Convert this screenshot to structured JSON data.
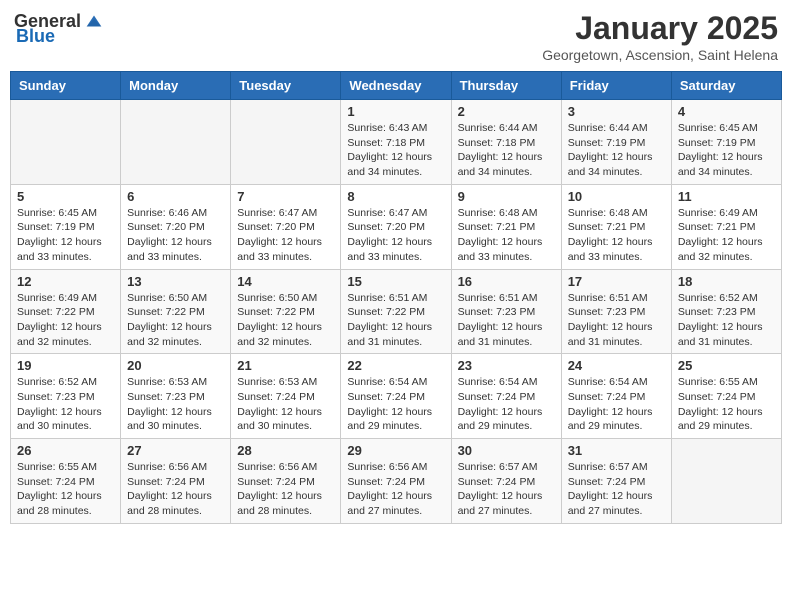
{
  "header": {
    "logo_general": "General",
    "logo_blue": "Blue",
    "month_title": "January 2025",
    "subtitle": "Georgetown, Ascension, Saint Helena"
  },
  "days_of_week": [
    "Sunday",
    "Monday",
    "Tuesday",
    "Wednesday",
    "Thursday",
    "Friday",
    "Saturday"
  ],
  "weeks": [
    [
      {
        "day": "",
        "info": ""
      },
      {
        "day": "",
        "info": ""
      },
      {
        "day": "",
        "info": ""
      },
      {
        "day": "1",
        "info": "Sunrise: 6:43 AM\nSunset: 7:18 PM\nDaylight: 12 hours\nand 34 minutes."
      },
      {
        "day": "2",
        "info": "Sunrise: 6:44 AM\nSunset: 7:18 PM\nDaylight: 12 hours\nand 34 minutes."
      },
      {
        "day": "3",
        "info": "Sunrise: 6:44 AM\nSunset: 7:19 PM\nDaylight: 12 hours\nand 34 minutes."
      },
      {
        "day": "4",
        "info": "Sunrise: 6:45 AM\nSunset: 7:19 PM\nDaylight: 12 hours\nand 34 minutes."
      }
    ],
    [
      {
        "day": "5",
        "info": "Sunrise: 6:45 AM\nSunset: 7:19 PM\nDaylight: 12 hours\nand 33 minutes."
      },
      {
        "day": "6",
        "info": "Sunrise: 6:46 AM\nSunset: 7:20 PM\nDaylight: 12 hours\nand 33 minutes."
      },
      {
        "day": "7",
        "info": "Sunrise: 6:47 AM\nSunset: 7:20 PM\nDaylight: 12 hours\nand 33 minutes."
      },
      {
        "day": "8",
        "info": "Sunrise: 6:47 AM\nSunset: 7:20 PM\nDaylight: 12 hours\nand 33 minutes."
      },
      {
        "day": "9",
        "info": "Sunrise: 6:48 AM\nSunset: 7:21 PM\nDaylight: 12 hours\nand 33 minutes."
      },
      {
        "day": "10",
        "info": "Sunrise: 6:48 AM\nSunset: 7:21 PM\nDaylight: 12 hours\nand 33 minutes."
      },
      {
        "day": "11",
        "info": "Sunrise: 6:49 AM\nSunset: 7:21 PM\nDaylight: 12 hours\nand 32 minutes."
      }
    ],
    [
      {
        "day": "12",
        "info": "Sunrise: 6:49 AM\nSunset: 7:22 PM\nDaylight: 12 hours\nand 32 minutes."
      },
      {
        "day": "13",
        "info": "Sunrise: 6:50 AM\nSunset: 7:22 PM\nDaylight: 12 hours\nand 32 minutes."
      },
      {
        "day": "14",
        "info": "Sunrise: 6:50 AM\nSunset: 7:22 PM\nDaylight: 12 hours\nand 32 minutes."
      },
      {
        "day": "15",
        "info": "Sunrise: 6:51 AM\nSunset: 7:22 PM\nDaylight: 12 hours\nand 31 minutes."
      },
      {
        "day": "16",
        "info": "Sunrise: 6:51 AM\nSunset: 7:23 PM\nDaylight: 12 hours\nand 31 minutes."
      },
      {
        "day": "17",
        "info": "Sunrise: 6:51 AM\nSunset: 7:23 PM\nDaylight: 12 hours\nand 31 minutes."
      },
      {
        "day": "18",
        "info": "Sunrise: 6:52 AM\nSunset: 7:23 PM\nDaylight: 12 hours\nand 31 minutes."
      }
    ],
    [
      {
        "day": "19",
        "info": "Sunrise: 6:52 AM\nSunset: 7:23 PM\nDaylight: 12 hours\nand 30 minutes."
      },
      {
        "day": "20",
        "info": "Sunrise: 6:53 AM\nSunset: 7:23 PM\nDaylight: 12 hours\nand 30 minutes."
      },
      {
        "day": "21",
        "info": "Sunrise: 6:53 AM\nSunset: 7:24 PM\nDaylight: 12 hours\nand 30 minutes."
      },
      {
        "day": "22",
        "info": "Sunrise: 6:54 AM\nSunset: 7:24 PM\nDaylight: 12 hours\nand 29 minutes."
      },
      {
        "day": "23",
        "info": "Sunrise: 6:54 AM\nSunset: 7:24 PM\nDaylight: 12 hours\nand 29 minutes."
      },
      {
        "day": "24",
        "info": "Sunrise: 6:54 AM\nSunset: 7:24 PM\nDaylight: 12 hours\nand 29 minutes."
      },
      {
        "day": "25",
        "info": "Sunrise: 6:55 AM\nSunset: 7:24 PM\nDaylight: 12 hours\nand 29 minutes."
      }
    ],
    [
      {
        "day": "26",
        "info": "Sunrise: 6:55 AM\nSunset: 7:24 PM\nDaylight: 12 hours\nand 28 minutes."
      },
      {
        "day": "27",
        "info": "Sunrise: 6:56 AM\nSunset: 7:24 PM\nDaylight: 12 hours\nand 28 minutes."
      },
      {
        "day": "28",
        "info": "Sunrise: 6:56 AM\nSunset: 7:24 PM\nDaylight: 12 hours\nand 28 minutes."
      },
      {
        "day": "29",
        "info": "Sunrise: 6:56 AM\nSunset: 7:24 PM\nDaylight: 12 hours\nand 27 minutes."
      },
      {
        "day": "30",
        "info": "Sunrise: 6:57 AM\nSunset: 7:24 PM\nDaylight: 12 hours\nand 27 minutes."
      },
      {
        "day": "31",
        "info": "Sunrise: 6:57 AM\nSunset: 7:24 PM\nDaylight: 12 hours\nand 27 minutes."
      },
      {
        "day": "",
        "info": ""
      }
    ]
  ]
}
